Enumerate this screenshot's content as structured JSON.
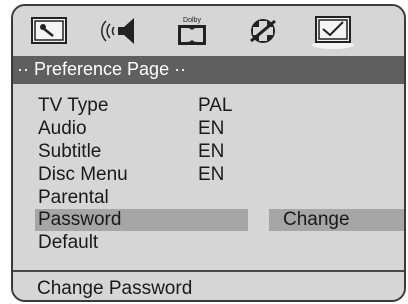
{
  "icons": [
    {
      "name": "general-setup-icon"
    },
    {
      "name": "audio-speaker-icon"
    },
    {
      "name": "dolby-icon",
      "label": "Dolby"
    },
    {
      "name": "video-setup-icon"
    },
    {
      "name": "preference-icon",
      "selected": true
    }
  ],
  "title": "·· Preference Page ··",
  "menu": [
    {
      "label": "TV Type",
      "value": "PAL"
    },
    {
      "label": "Audio",
      "value": "EN"
    },
    {
      "label": "Subtitle",
      "value": "EN"
    },
    {
      "label": "Disc Menu",
      "value": "EN"
    },
    {
      "label": "Parental",
      "value": ""
    },
    {
      "label": "Password",
      "value": "",
      "highlighted": true
    },
    {
      "label": "Default",
      "value": ""
    }
  ],
  "submenu": {
    "option": "Change"
  },
  "status": "Change Password",
  "colors": {
    "background": "#d6d6d6",
    "title_bar": "#5f5f5f",
    "highlight": "#a6a6a6",
    "border": "#3a3a3a"
  }
}
